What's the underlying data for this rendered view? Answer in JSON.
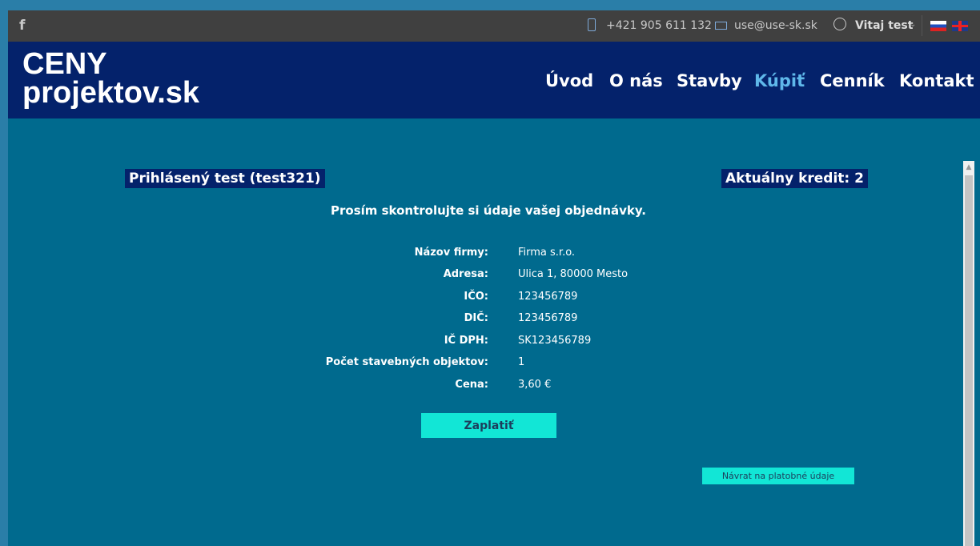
{
  "topbar": {
    "facebook_icon": "facebook-icon",
    "phone": "+421 905 611 132",
    "email": "use@use-sk.sk",
    "user_greeting": "Vitaj test"
  },
  "header": {
    "logo_line1": "CENY",
    "logo_line2": "projektov.sk",
    "nav": [
      "Úvod",
      "O nás",
      "Stavby",
      "Kúpiť",
      "Cenník",
      "Kontakt"
    ],
    "active_nav": "Kúpiť"
  },
  "main": {
    "logged_in": "Prihlásený test (test321)",
    "credit": "Aktuálny kredit: 2",
    "heading": "Prosím skontrolujte si údaje vašej objednávky.",
    "fields": [
      {
        "label": "Názov firmy:",
        "value": "Firma s.r.o."
      },
      {
        "label": "Adresa:",
        "value": "Ulica 1, 80000 Mesto"
      },
      {
        "label": "IČO:",
        "value": "123456789"
      },
      {
        "label": "DIČ:",
        "value": "123456789"
      },
      {
        "label": "IČ DPH:",
        "value": "SK123456789"
      },
      {
        "label": "Počet stavebných objektov:",
        "value": "1"
      },
      {
        "label": "Cena:",
        "value": "3,60 €"
      }
    ],
    "pay_button": "Zaplatiť",
    "back_button": "Návrat na platobné údaje"
  },
  "colors": {
    "page_bg": "#006a8e",
    "header_bg": "#04226b",
    "topbar_bg": "#404040",
    "button_bg": "#12e6d6",
    "active_nav": "#5fb8ea"
  }
}
